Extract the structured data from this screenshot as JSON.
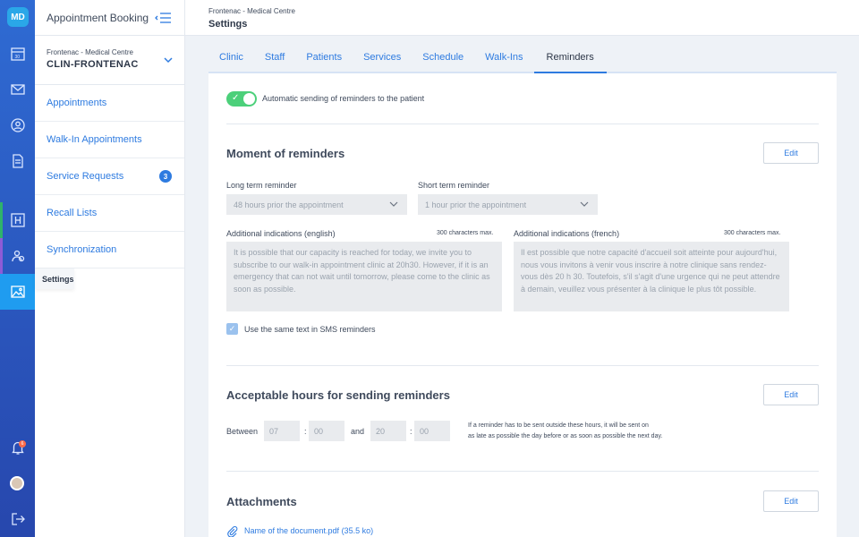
{
  "app": {
    "logo": "MD",
    "title": "Appointment Booking"
  },
  "rail": {
    "items": [
      "calendar-icon",
      "mail-icon",
      "user-circle-icon",
      "document-icon",
      "hospital-icon",
      "users-icon",
      "image-icon"
    ],
    "notifications": "6",
    "colors": {
      "accent": "#1f9cf0",
      "mark_green": "#2fb36b",
      "mark_purple": "#8e5bd6"
    }
  },
  "clinic": {
    "subtitle": "Frontenac - Medical Centre",
    "code": "CLIN-FRONTENAC"
  },
  "sidebar": {
    "items": [
      {
        "label": "Appointments"
      },
      {
        "label": "Walk-In Appointments"
      },
      {
        "label": "Service Requests",
        "count": "3"
      },
      {
        "label": "Recall Lists"
      },
      {
        "label": "Synchronization"
      },
      {
        "label": "Settings"
      }
    ]
  },
  "header": {
    "breadcrumb": "Frontenac - Medical Centre",
    "title": "Settings"
  },
  "tabs": [
    "Clinic",
    "Staff",
    "Patients",
    "Services",
    "Schedule",
    "Walk-Ins",
    "Reminders"
  ],
  "auto_reminders": {
    "label": "Automatic sending of reminders to the patient",
    "enabled": true
  },
  "moment": {
    "title": "Moment of reminders",
    "edit": "Edit",
    "long_label": "Long term reminder",
    "long_value": "48 hours prior the appointment",
    "short_label": "Short term reminder",
    "short_value": "1 hour prior the appointment",
    "en_label": "Additional indications (english)",
    "en_max": "300 characters max.",
    "en_text": "It is possible that our capacity is reached for today, we invite you to subscribe to our walk-in appointment clinic at 20h30. However, if it is an emergency that can not wait until tomorrow, please come to the clinic as soon as possible.",
    "fr_label": "Additional indications (french)",
    "fr_max": "300 characters max.",
    "fr_text": "Il est possible que notre capacité d'accueil soit atteinte pour aujourd'hui, nous vous invitons à venir vous inscrire à notre clinique sans rendez-vous dès 20 h 30. Toutefois, s'il s'agit d'une urgence qui ne peut attendre à demain, veuillez vous présenter à la clinique le plus tôt possible.",
    "sms_label": "Use the same text in SMS reminders",
    "sms_checked": true
  },
  "hours": {
    "title": "Acceptable hours for sending reminders",
    "edit": "Edit",
    "between": "Between",
    "start_h": "07",
    "start_m": "00",
    "and": "and",
    "end_h": "20",
    "end_m": "00",
    "colon": ":",
    "note_1": "If a reminder has to be sent outside these hours, it will be sent on",
    "note_2": "as late as possible the day before or as soon as possible the next day."
  },
  "attachments": {
    "title": "Attachments",
    "edit": "Edit",
    "file": "Name of the document.pdf (35.5 ko)"
  }
}
